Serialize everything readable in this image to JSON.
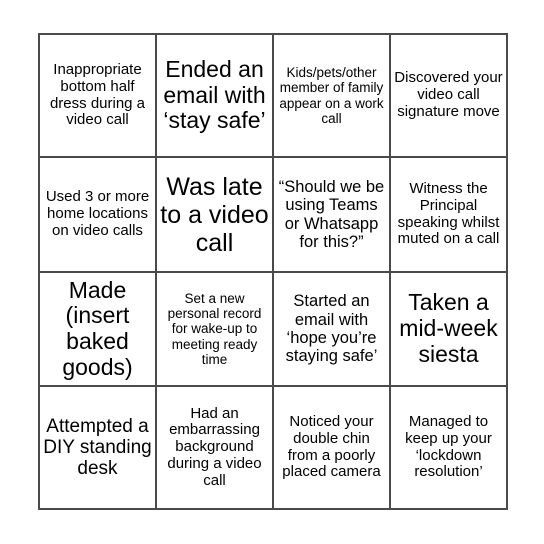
{
  "document": {
    "type": "bingo-card",
    "columns": 4,
    "rows": 4,
    "border_color": "#4a4a4a",
    "text_color": "#000000",
    "background_color": "#ffffff"
  },
  "grid": {
    "rows": [
      {
        "cells": [
          {
            "text": "Inappropriate bottom half dress during a video call",
            "size": "sm"
          },
          {
            "text": "Ended an email with ‘stay safe’",
            "size": "xl"
          },
          {
            "text": "Kids/pets/other member of family appear on a work call",
            "size": "xs"
          },
          {
            "text": "Discovered your video call signature move",
            "size": "sm"
          }
        ]
      },
      {
        "cells": [
          {
            "text": "Used 3 or more home locations on video calls",
            "size": "sm"
          },
          {
            "text": "Was late to a video call",
            "size": "xxl"
          },
          {
            "text": "“Should we be using Teams or Whatsapp for this?”",
            "size": "md"
          },
          {
            "text": "Witness the Principal speaking whilst muted on a call",
            "size": "sm"
          }
        ]
      },
      {
        "cells": [
          {
            "text": "Made (insert baked goods)",
            "size": "xl"
          },
          {
            "text": "Set a new personal record for wake-up to meeting ready time",
            "size": "xs"
          },
          {
            "text": "Started an email with ‘hope you’re staying safe’",
            "size": "md"
          },
          {
            "text": "Taken a mid-week siesta",
            "size": "xl"
          }
        ]
      },
      {
        "cells": [
          {
            "text": "Attempted a DIY standing desk",
            "size": "lg"
          },
          {
            "text": "Had an embarrassing background during a video call",
            "size": "sm"
          },
          {
            "text": "Noticed your double chin from a poorly placed camera",
            "size": "sm"
          },
          {
            "text": "Managed to keep up your ‘lockdown resolution’",
            "size": "sm"
          }
        ]
      }
    ]
  }
}
